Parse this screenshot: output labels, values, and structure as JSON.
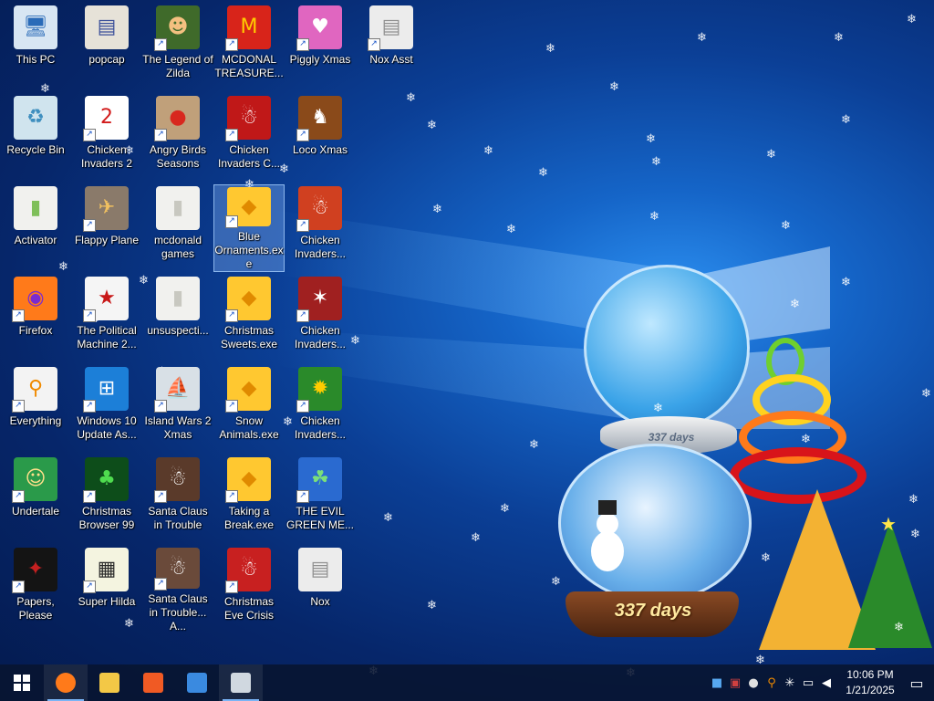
{
  "desktop": {
    "icons": [
      {
        "label": "This PC",
        "icon": "this-pc-icon",
        "sym": "🖥",
        "bg": "#d8e6f3",
        "fg": "#2a6bb8",
        "shortcut": false
      },
      {
        "label": "Recycle Bin",
        "icon": "recycle-bin-icon",
        "sym": "♻",
        "bg": "#d0e4ee",
        "fg": "#3f8fbf",
        "shortcut": false
      },
      {
        "label": "Activator",
        "icon": "folder-icon",
        "sym": "▮",
        "bg": "#f1f1ee",
        "fg": "#7fbf5a",
        "shortcut": false
      },
      {
        "label": "Firefox",
        "icon": "firefox-icon",
        "sym": "◉",
        "bg": "#ff7a1a",
        "fg": "#7a2bd0",
        "shortcut": true
      },
      {
        "label": "Everything",
        "icon": "everything-search-icon",
        "sym": "⚲",
        "bg": "#f3f3f3",
        "fg": "#f08a00",
        "shortcut": true
      },
      {
        "label": "Undertale",
        "icon": "undertale-icon",
        "sym": "☺",
        "bg": "#2a9a4a",
        "fg": "#ffe08a",
        "shortcut": true
      },
      {
        "label": "Papers, Please",
        "icon": "papers-please-icon",
        "sym": "✦",
        "bg": "#141414",
        "fg": "#c42020",
        "shortcut": true
      },
      {
        "label": "popcap",
        "icon": "popcap-folder-icon",
        "sym": "▤",
        "bg": "#e6e2d8",
        "fg": "#3a4f9a",
        "shortcut": false
      },
      {
        "label": "Chicken Invaders 2",
        "icon": "chicken-invaders-icon",
        "sym": "2",
        "bg": "#ffffff",
        "fg": "#d21b1b",
        "shortcut": true
      },
      {
        "label": "Flappy Plane",
        "icon": "flappy-plane-icon",
        "sym": "✈",
        "bg": "#8a7a6a",
        "fg": "#f0c060",
        "shortcut": true
      },
      {
        "label": "The Political Machine 2...",
        "icon": "political-machine-icon",
        "sym": "★",
        "bg": "#f5f5f5",
        "fg": "#c81818",
        "shortcut": true
      },
      {
        "label": "Windows 10 Update As...",
        "icon": "windows-logo-icon",
        "sym": "⊞",
        "bg": "#1c7fd8",
        "fg": "#ffffff",
        "shortcut": true
      },
      {
        "label": "Christmas Browser 99",
        "icon": "christmas-tree-icon",
        "sym": "♣",
        "bg": "#0d4d1a",
        "fg": "#4fdc4f",
        "shortcut": true
      },
      {
        "label": "Super Hilda",
        "icon": "super-hilda-icon",
        "sym": "▦",
        "bg": "#f4f4e0",
        "fg": "#2a2a2a",
        "shortcut": true
      },
      {
        "label": "The Legend of Zilda",
        "icon": "zilda-icon",
        "sym": "☻",
        "bg": "#3f6a2a",
        "fg": "#f3c080",
        "shortcut": true
      },
      {
        "label": "Angry Birds Seasons",
        "icon": "angry-birds-icon",
        "sym": "●",
        "bg": "#c0a07a",
        "fg": "#d8281e",
        "shortcut": true
      },
      {
        "label": "mcdonald games",
        "icon": "folder-icon",
        "sym": "▮",
        "bg": "#f1f1ee",
        "fg": "#c8c8c0",
        "shortcut": false
      },
      {
        "label": "unsuspecti...",
        "icon": "folder-icon",
        "sym": "▮",
        "bg": "#f1f1ee",
        "fg": "#c8c8c0",
        "shortcut": false
      },
      {
        "label": "Island Wars 2 Xmas",
        "icon": "island-wars-icon",
        "sym": "⛵",
        "bg": "#d8e0e6",
        "fg": "#4a5a6a",
        "shortcut": true
      },
      {
        "label": "Santa Claus in Trouble",
        "icon": "santa-icon",
        "sym": "☃",
        "bg": "#5a3a2a",
        "fg": "#ffffff",
        "shortcut": true
      },
      {
        "label": "Santa Claus in Trouble... A...",
        "icon": "santa-icon",
        "sym": "☃",
        "bg": "#6a4a3a",
        "fg": "#ffffff",
        "shortcut": true
      },
      {
        "label": "MCDONAL TREASURE...",
        "icon": "mcdonalds-icon",
        "sym": "M",
        "bg": "#d8241a",
        "fg": "#ffcc00",
        "shortcut": true
      },
      {
        "label": "Chicken Invaders C...",
        "icon": "chicken-invaders-icon",
        "sym": "☃",
        "bg": "#c01818",
        "fg": "#ffffff",
        "shortcut": true
      },
      {
        "label": "Blue Ornaments.exe",
        "icon": "exe-icon",
        "sym": "◆",
        "bg": "#ffc830",
        "fg": "#e08a00",
        "shortcut": true
      },
      {
        "label": "Christmas Sweets.exe",
        "icon": "exe-icon",
        "sym": "◆",
        "bg": "#ffc830",
        "fg": "#e08a00",
        "shortcut": true
      },
      {
        "label": "Snow Animals.exe",
        "icon": "exe-icon",
        "sym": "◆",
        "bg": "#ffc830",
        "fg": "#e08a00",
        "shortcut": true
      },
      {
        "label": "Taking a Break.exe",
        "icon": "exe-icon",
        "sym": "◆",
        "bg": "#ffc830",
        "fg": "#e08a00",
        "shortcut": true
      },
      {
        "label": "Christmas Eve Crisis",
        "icon": "santa-icon",
        "sym": "☃",
        "bg": "#c82020",
        "fg": "#ffffff",
        "shortcut": true
      },
      {
        "label": "Piggly Xmas",
        "icon": "piggly-xmas-icon",
        "sym": "♥",
        "bg": "#e066c0",
        "fg": "#ffffff",
        "shortcut": true
      },
      {
        "label": "Loco Xmas",
        "icon": "loco-xmas-icon",
        "sym": "♞",
        "bg": "#8a4a1a",
        "fg": "#ffffff",
        "shortcut": true
      },
      {
        "label": "Chicken Invaders...",
        "icon": "chicken-invaders-icon",
        "sym": "☃",
        "bg": "#d04020",
        "fg": "#ffffff",
        "shortcut": true
      },
      {
        "label": "Chicken Invaders...",
        "icon": "chicken-invaders-icon",
        "sym": "✶",
        "bg": "#a02020",
        "fg": "#ffffff",
        "shortcut": true
      },
      {
        "label": "Chicken Invaders...",
        "icon": "chicken-invaders-icon",
        "sym": "✹",
        "bg": "#2a8a2a",
        "fg": "#ffcc00",
        "shortcut": true
      },
      {
        "label": "THE EVIL GREEN ME...",
        "icon": "evil-green-me-icon",
        "sym": "☘",
        "bg": "#2a6ad0",
        "fg": "#7ae07a",
        "shortcut": true
      },
      {
        "label": "Nox",
        "icon": "file-icon",
        "sym": "▤",
        "bg": "#ececec",
        "fg": "#909090",
        "shortcut": false
      },
      {
        "label": "Nox Asst",
        "icon": "file-icon",
        "sym": "▤",
        "bg": "#ececec",
        "fg": "#909090",
        "shortcut": true
      }
    ],
    "selected_label": "Blue Ornaments.exe",
    "countdown_top": "337 days",
    "countdown_bottom": "337 days"
  },
  "taskbar": {
    "start_icon": "windows-start-icon",
    "pinned": [
      {
        "name": "firefox",
        "icon": "firefox-icon",
        "color": "#ff7a1a",
        "active": true
      },
      {
        "name": "file-explorer",
        "icon": "folder-icon",
        "color": "#f3c846",
        "active": false
      },
      {
        "name": "brave",
        "icon": "brave-icon",
        "color": "#f05a24",
        "active": false
      },
      {
        "name": "msn-messenger",
        "icon": "messenger-icon",
        "color": "#3a8ae0",
        "active": false
      },
      {
        "name": "xmas-app",
        "icon": "window-icon",
        "color": "#d0d8e0",
        "active": true
      }
    ],
    "tray": [
      {
        "icon": "notes-icon",
        "sym": "■",
        "color": "#57a8f0"
      },
      {
        "icon": "app-icon",
        "sym": "▣",
        "color": "#d04040"
      },
      {
        "icon": "drop-icon",
        "sym": "●",
        "color": "#e0e0e0"
      },
      {
        "icon": "search-tray-icon",
        "sym": "⚲",
        "color": "#f08a00"
      },
      {
        "icon": "snowflake-tray-icon",
        "sym": "✳",
        "color": "#ffffff"
      },
      {
        "icon": "network-icon",
        "sym": "▭",
        "color": "#ffffff"
      },
      {
        "icon": "volume-muted-icon",
        "sym": "◀",
        "color": "#ffffff"
      }
    ],
    "time": "10:06 PM",
    "date": "1/21/2025"
  }
}
